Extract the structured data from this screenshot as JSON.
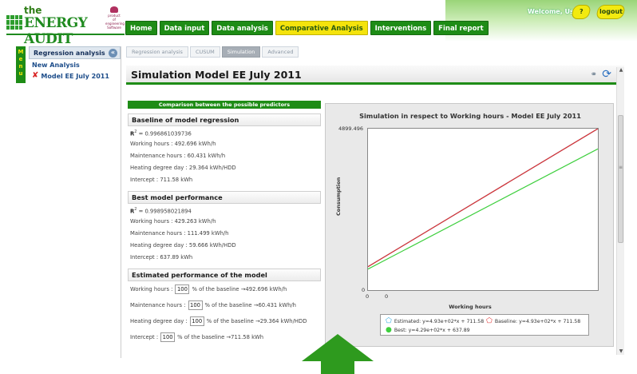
{
  "header": {
    "logo": {
      "small": "the",
      "main": "ENERGY AUDIT",
      "tail": ""
    },
    "partner": [
      "product",
      "of",
      "engineering",
      "Software"
    ],
    "welcome": "Welcome, User.",
    "help_label": "?",
    "logout_label": "logout",
    "nav": [
      {
        "label": "Home",
        "active": false
      },
      {
        "label": "Data input",
        "active": false
      },
      {
        "label": "Data analysis",
        "active": false
      },
      {
        "label": "Comparative Analysis",
        "active": true
      },
      {
        "label": "Interventions",
        "active": false
      },
      {
        "label": "Final report",
        "active": false
      }
    ]
  },
  "menu_tab": "Menu",
  "sidebar": {
    "title": "Regression analysis",
    "new_link": "New Analysis",
    "items": [
      {
        "label": "Model EE July 2011"
      }
    ]
  },
  "subtabs": [
    {
      "label": "Regression analysis",
      "active": false
    },
    {
      "label": "CUSUM",
      "active": false
    },
    {
      "label": "Simulation",
      "active": true
    },
    {
      "label": "Advanced",
      "active": false
    }
  ],
  "panel_title": "Simulation Model EE July 2011",
  "info": {
    "band": "Comparison between the possible predictors",
    "baseline": {
      "title": "Baseline of model regression",
      "r2_label": "R",
      "r2_sup": "2",
      "r2_value": " = 0.996861039736",
      "lines": [
        "Working hours : 492.696 kWh/h",
        "Maintenance hours : 60.431 kWh/h",
        "Heating degree day : 29.364 kWh/HDD",
        "Intercept : 711.58 kWh"
      ]
    },
    "best": {
      "title": "Best model performance",
      "r2_label": "R",
      "r2_sup": "2",
      "r2_value": " = 0.998958021894",
      "lines": [
        "Working hours : 429.263 kWh/h",
        "Maintenance hours : 111.499 kWh/h",
        "Heating degree day : 59.666 kWh/HDD",
        "Intercept : 637.89 kWh"
      ]
    },
    "estimated": {
      "title": "Estimated performance of the model",
      "rows": [
        {
          "pre": "Working hours :",
          "value": "100",
          "post": "% of the baseline →492.696 kWh/h"
        },
        {
          "pre": "Maintenance hours :",
          "value": "100",
          "post": "% of the baseline →60.431 kWh/h"
        },
        {
          "pre": "Heating degree day :",
          "value": "100",
          "post": "% of the baseline →29.364 kWh/HDD"
        },
        {
          "pre": "Intercept :",
          "value": "100",
          "post": "% of the baseline →711.58 kWh"
        }
      ]
    }
  },
  "chart_data": {
    "type": "line",
    "title": "Simulation in respect to Working hours - Model EE July 2011",
    "xlabel": "Working hours",
    "ylabel": "Consumption",
    "ytick_labels": [
      "4899.496",
      "0"
    ],
    "xtick_labels": [
      "0",
      "0"
    ],
    "ylim": [
      0,
      4899.496
    ],
    "xlim": [
      0,
      8.5
    ],
    "grid": false,
    "legend_position": "bottom",
    "series": [
      {
        "name": "Estimated: y=4.93e+02*x + 711.58",
        "color": "#2aa8e0",
        "marker": "pentagon-outline",
        "slope": 492.696,
        "intercept": 711.58,
        "x": [
          0,
          8.5
        ],
        "y": [
          711.58,
          4899.496
        ]
      },
      {
        "name": "Baseline: y=4.93e+02*x + 711.58",
        "color": "#e03030",
        "marker": "pentagon-outline",
        "slope": 492.696,
        "intercept": 711.58,
        "x": [
          0,
          8.5
        ],
        "y": [
          711.58,
          4899.496
        ]
      },
      {
        "name": "Best: y=4.29e+02*x + 637.89",
        "color": "#3ecf3e",
        "marker": "circle",
        "slope": 429.263,
        "intercept": 637.89,
        "x": [
          0,
          8.5
        ],
        "y": [
          637.89,
          4286.63
        ]
      }
    ]
  },
  "colors": {
    "brand_green": "#1e8c16",
    "accent_yellow": "#f4e30c",
    "arrow_green": "#2e9a1e"
  }
}
